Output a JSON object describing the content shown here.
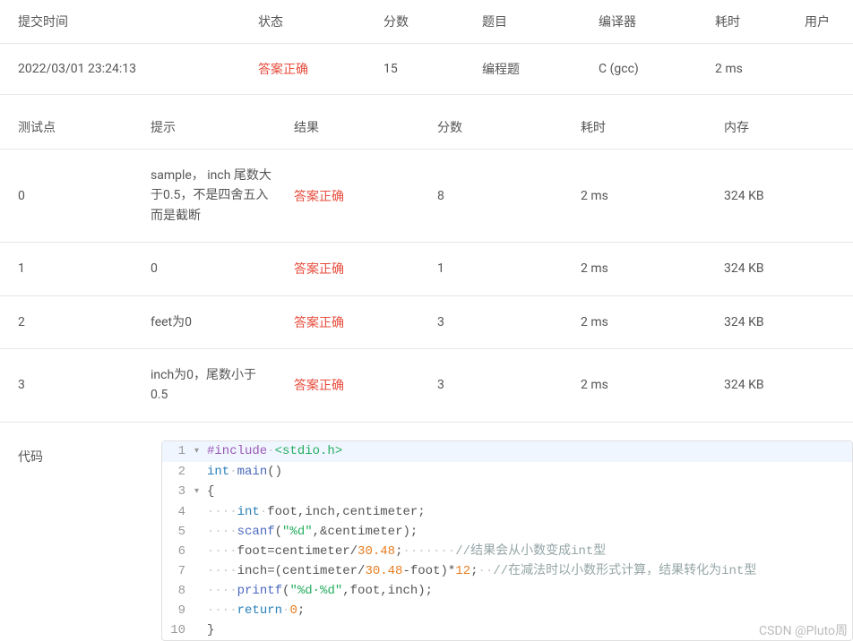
{
  "summary": {
    "headers": {
      "submit_time": "提交时间",
      "status": "状态",
      "score": "分数",
      "problem": "题目",
      "compiler": "编译器",
      "time": "耗时",
      "user": "用户"
    },
    "row": {
      "submit_time": "2022/03/01 23:24:13",
      "status": "答案正确",
      "score": "15",
      "problem": "编程题",
      "compiler": "C (gcc)",
      "time": "2 ms",
      "user": ""
    }
  },
  "tests": {
    "headers": {
      "point": "测试点",
      "hint": "提示",
      "result": "结果",
      "score": "分数",
      "time": "耗时",
      "memory": "内存"
    },
    "rows": [
      {
        "point": "0",
        "hint": "sample， inch 尾数大于0.5，不是四舍五入而是截断",
        "result": "答案正确",
        "score": "8",
        "time": "2 ms",
        "memory": "324 KB"
      },
      {
        "point": "1",
        "hint": "0",
        "result": "答案正确",
        "score": "1",
        "time": "2 ms",
        "memory": "324 KB"
      },
      {
        "point": "2",
        "hint": "feet为0",
        "result": "答案正确",
        "score": "3",
        "time": "2 ms",
        "memory": "324 KB"
      },
      {
        "point": "3",
        "hint": "inch为0，尾数小于0.5",
        "result": "答案正确",
        "score": "3",
        "time": "2 ms",
        "memory": "324 KB"
      }
    ]
  },
  "code": {
    "label": "代码",
    "lines": [
      {
        "n": "1",
        "fold": "▾",
        "highlight": true,
        "tokens": [
          {
            "t": "preproc",
            "v": "#include"
          },
          {
            "t": "ws",
            "v": "·"
          },
          {
            "t": "angle",
            "v": "<stdio.h>"
          }
        ]
      },
      {
        "n": "2",
        "tokens": [
          {
            "t": "keyword",
            "v": "int"
          },
          {
            "t": "ws",
            "v": "·"
          },
          {
            "t": "func",
            "v": "main"
          },
          {
            "t": "punct",
            "v": "()"
          }
        ]
      },
      {
        "n": "3",
        "fold": "▾",
        "tokens": [
          {
            "t": "punct",
            "v": "{"
          }
        ]
      },
      {
        "n": "4",
        "tokens": [
          {
            "t": "ws",
            "v": "····"
          },
          {
            "t": "keyword",
            "v": "int"
          },
          {
            "t": "ws",
            "v": "·"
          },
          {
            "t": "ident",
            "v": "foot"
          },
          {
            "t": "punct",
            "v": ","
          },
          {
            "t": "ident",
            "v": "inch"
          },
          {
            "t": "punct",
            "v": ","
          },
          {
            "t": "ident",
            "v": "centimeter"
          },
          {
            "t": "punct",
            "v": ";"
          }
        ]
      },
      {
        "n": "5",
        "tokens": [
          {
            "t": "ws",
            "v": "····"
          },
          {
            "t": "func",
            "v": "scanf"
          },
          {
            "t": "punct",
            "v": "("
          },
          {
            "t": "string",
            "v": "\"%d\""
          },
          {
            "t": "punct",
            "v": ","
          },
          {
            "t": "punct",
            "v": "&"
          },
          {
            "t": "ident",
            "v": "centimeter"
          },
          {
            "t": "punct",
            "v": ");"
          }
        ]
      },
      {
        "n": "6",
        "tokens": [
          {
            "t": "ws",
            "v": "····"
          },
          {
            "t": "ident",
            "v": "foot"
          },
          {
            "t": "punct",
            "v": "="
          },
          {
            "t": "ident",
            "v": "centimeter"
          },
          {
            "t": "punct",
            "v": "/"
          },
          {
            "t": "number",
            "v": "30.48"
          },
          {
            "t": "punct",
            "v": ";"
          },
          {
            "t": "ws",
            "v": "·······"
          },
          {
            "t": "comment",
            "v": "//结果会从小数变成int型"
          }
        ]
      },
      {
        "n": "7",
        "tokens": [
          {
            "t": "ws",
            "v": "····"
          },
          {
            "t": "ident",
            "v": "inch"
          },
          {
            "t": "punct",
            "v": "=("
          },
          {
            "t": "ident",
            "v": "centimeter"
          },
          {
            "t": "punct",
            "v": "/"
          },
          {
            "t": "number",
            "v": "30.48"
          },
          {
            "t": "punct",
            "v": "-"
          },
          {
            "t": "ident",
            "v": "foot"
          },
          {
            "t": "punct",
            "v": ")*"
          },
          {
            "t": "number",
            "v": "12"
          },
          {
            "t": "punct",
            "v": ";"
          },
          {
            "t": "ws",
            "v": "··"
          },
          {
            "t": "comment",
            "v": "//在减法时以小数形式计算，结果转化为int型"
          }
        ]
      },
      {
        "n": "8",
        "tokens": [
          {
            "t": "ws",
            "v": "····"
          },
          {
            "t": "func",
            "v": "printf"
          },
          {
            "t": "punct",
            "v": "("
          },
          {
            "t": "string",
            "v": "\"%d·%d\""
          },
          {
            "t": "punct",
            "v": ","
          },
          {
            "t": "ident",
            "v": "foot"
          },
          {
            "t": "punct",
            "v": ","
          },
          {
            "t": "ident",
            "v": "inch"
          },
          {
            "t": "punct",
            "v": ");"
          }
        ]
      },
      {
        "n": "9",
        "tokens": [
          {
            "t": "ws",
            "v": "····"
          },
          {
            "t": "keyword",
            "v": "return"
          },
          {
            "t": "ws",
            "v": "·"
          },
          {
            "t": "number",
            "v": "0"
          },
          {
            "t": "punct",
            "v": ";"
          }
        ]
      },
      {
        "n": "10",
        "tokens": [
          {
            "t": "punct",
            "v": "}"
          }
        ]
      }
    ]
  },
  "watermark": "CSDN @Pluto周"
}
